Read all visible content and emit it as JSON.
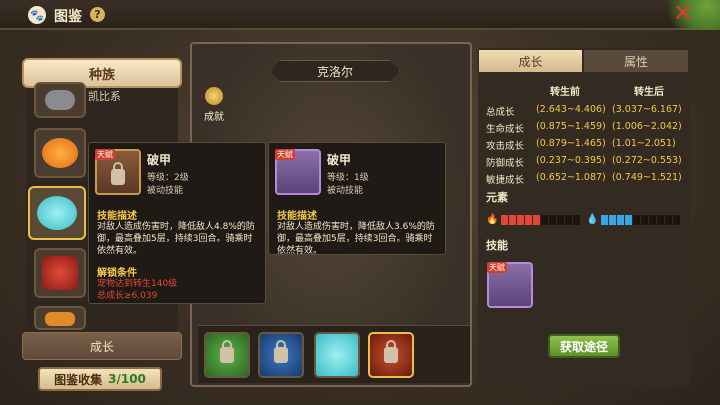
{
  "header": {
    "title": "图鉴",
    "help": "?",
    "close": "✕"
  },
  "left": {
    "race_tab": "种族",
    "first_item_name": "凯比系",
    "growth_tab": "成长",
    "collection_label": "图鉴收集",
    "collection_count": "3/100"
  },
  "center": {
    "pet_name": "克洛尔",
    "achievement": "成就"
  },
  "popup_left": {
    "tag": "天赋",
    "skill_name": "破甲",
    "level": "等级：2级",
    "type": "被动技能",
    "desc_title": "技能描述",
    "desc": "对敌人造成伤害时，降低敌人4.8%的防御，最高叠加5层，持续3回合。骑乘时依然有效。",
    "unlock_title": "解锁条件",
    "unlock_line1": "宠物达到转生140级",
    "unlock_line2": "总成长≥6.039"
  },
  "popup_right": {
    "tag": "天赋",
    "skill_name": "破甲",
    "level": "等级：1级",
    "type": "被动技能",
    "desc_title": "技能描述",
    "desc": "对敌人造成伤害时，降低敌人3.6%的防御，最高叠加5层，持续3回合。骑乘时依然有效。"
  },
  "right": {
    "tab_growth": "成长",
    "tab_attr": "属性",
    "col_before": "转生前",
    "col_after": "转生后",
    "rows": [
      {
        "label": "总成长",
        "before": "(2.643~4.406)",
        "after": "(3.037~6.167)"
      },
      {
        "label": "生命成长",
        "before": "(0.875~1.459)",
        "after": "(1.006~2.042)"
      },
      {
        "label": "攻击成长",
        "before": "(0.879~1.465)",
        "after": "(1.01~2.051)"
      },
      {
        "label": "防御成长",
        "before": "(0.237~0.395)",
        "after": "(0.272~0.553)"
      },
      {
        "label": "敏捷成长",
        "before": "(0.652~1.087)",
        "after": "(0.749~1.521)"
      }
    ],
    "element_title": "元素",
    "fire_level": 5,
    "water_level": 4,
    "element_max": 10,
    "skill_title": "技能",
    "skill_tag": "天赋",
    "get_button": "获取途径"
  },
  "colors": {
    "fire": "#e0453a",
    "water": "#3aa6e6",
    "empty": "#1a1510",
    "accent": "#f2c94c"
  }
}
